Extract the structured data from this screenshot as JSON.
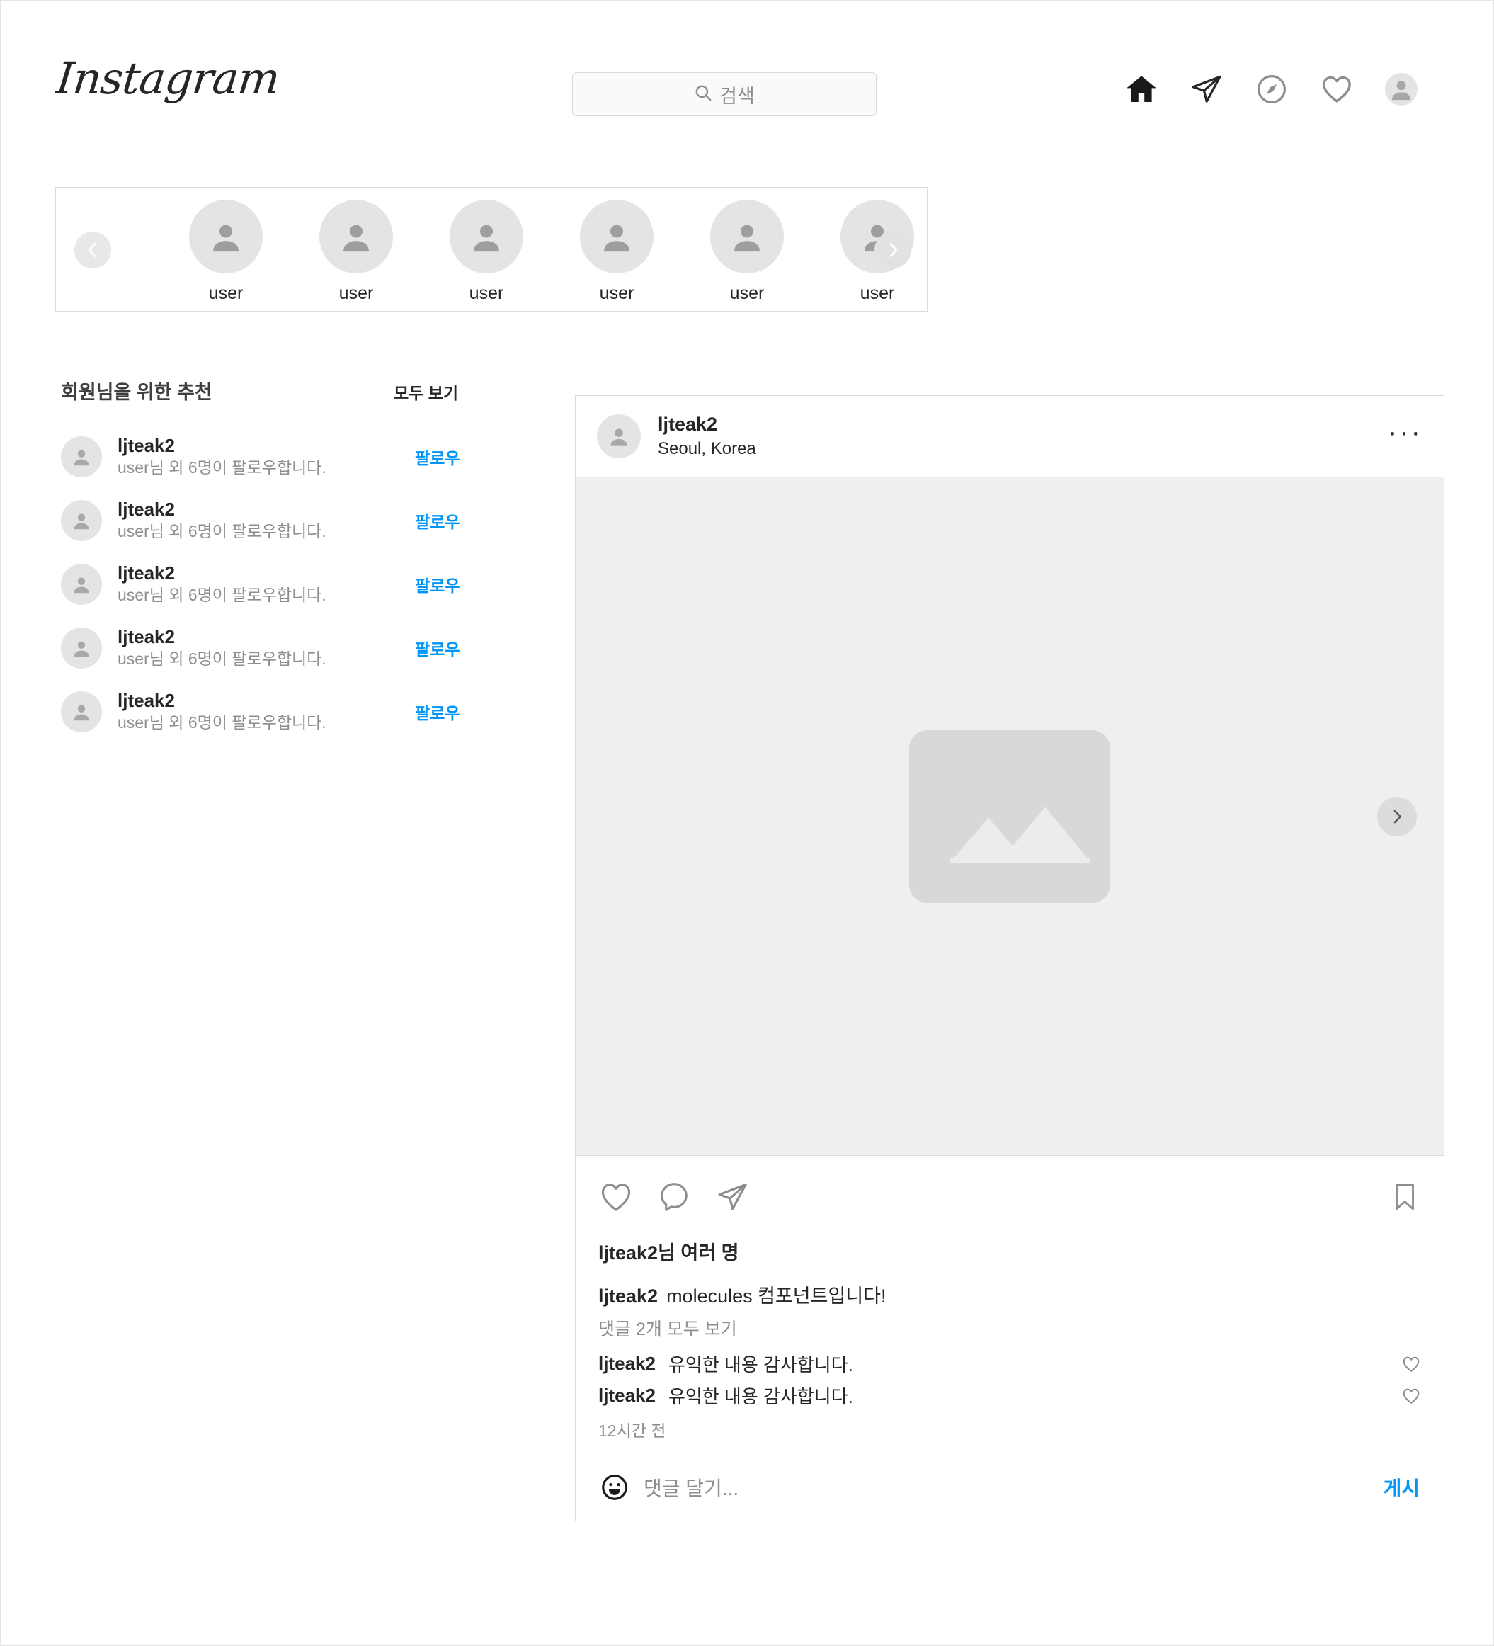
{
  "brand": {
    "logo_text": "Instagram",
    "accent_color": "#0095f6",
    "text_color": "#262626",
    "muted_color": "#8e8e8e",
    "border_color": "#dbdbdb"
  },
  "header": {
    "search": {
      "placeholder": "검색",
      "icon": "search-icon"
    },
    "nav": [
      {
        "name": "home-icon",
        "label": "홈"
      },
      {
        "name": "direct-send-icon",
        "label": "메시지"
      },
      {
        "name": "compass-explore-icon",
        "label": "탐색"
      },
      {
        "name": "heart-activity-icon",
        "label": "활동"
      },
      {
        "name": "profile-avatar-icon",
        "label": "프로필"
      }
    ]
  },
  "stories": {
    "prev_icon": "chevron-left-icon",
    "next_icon": "chevron-right-icon",
    "items": [
      {
        "label": "user"
      },
      {
        "label": "user"
      },
      {
        "label": "user"
      },
      {
        "label": "user"
      },
      {
        "label": "user"
      },
      {
        "label": "user"
      }
    ]
  },
  "suggestions": {
    "title": "회원님을 위한 추천",
    "see_all": "모두 보기",
    "items": [
      {
        "username": "ljteak2",
        "subtitle": "user님 외 6명이 팔로우합니다.",
        "action": "팔로우"
      },
      {
        "username": "ljteak2",
        "subtitle": "user님 외 6명이 팔로우합니다.",
        "action": "팔로우"
      },
      {
        "username": "ljteak2",
        "subtitle": "user님 외 6명이 팔로우합니다.",
        "action": "팔로우"
      },
      {
        "username": "ljteak2",
        "subtitle": "user님 외 6명이 팔로우합니다.",
        "action": "팔로우"
      },
      {
        "username": "ljteak2",
        "subtitle": "user님 외 6명이 팔로우합니다.",
        "action": "팔로우"
      }
    ]
  },
  "post": {
    "username": "ljteak2",
    "location": "Seoul, Korea",
    "more_menu": "···",
    "media": {
      "placeholder_icon": "image-placeholder-icon",
      "next_icon": "chevron-right-icon"
    },
    "actions": {
      "like": "heart-icon",
      "comment": "comment-bubble-icon",
      "share": "send-paper-plane-icon",
      "save": "bookmark-icon"
    },
    "likes_text": "ljteak2님 여러 명",
    "caption_user": "ljteak2",
    "caption_text": "molecules 컴포넌트입니다!",
    "view_all_comments": "댓글 2개 모두 보기",
    "comments": [
      {
        "username": "ljteak2",
        "text": "유익한 내용 감사합니다."
      },
      {
        "username": "ljteak2",
        "text": "유익한 내용 감사합니다."
      }
    ],
    "time_ago": "12시간 전",
    "input": {
      "emoji_icon": "emoji-smiley-icon",
      "placeholder": "댓글 달기...",
      "submit_label": "게시"
    }
  }
}
